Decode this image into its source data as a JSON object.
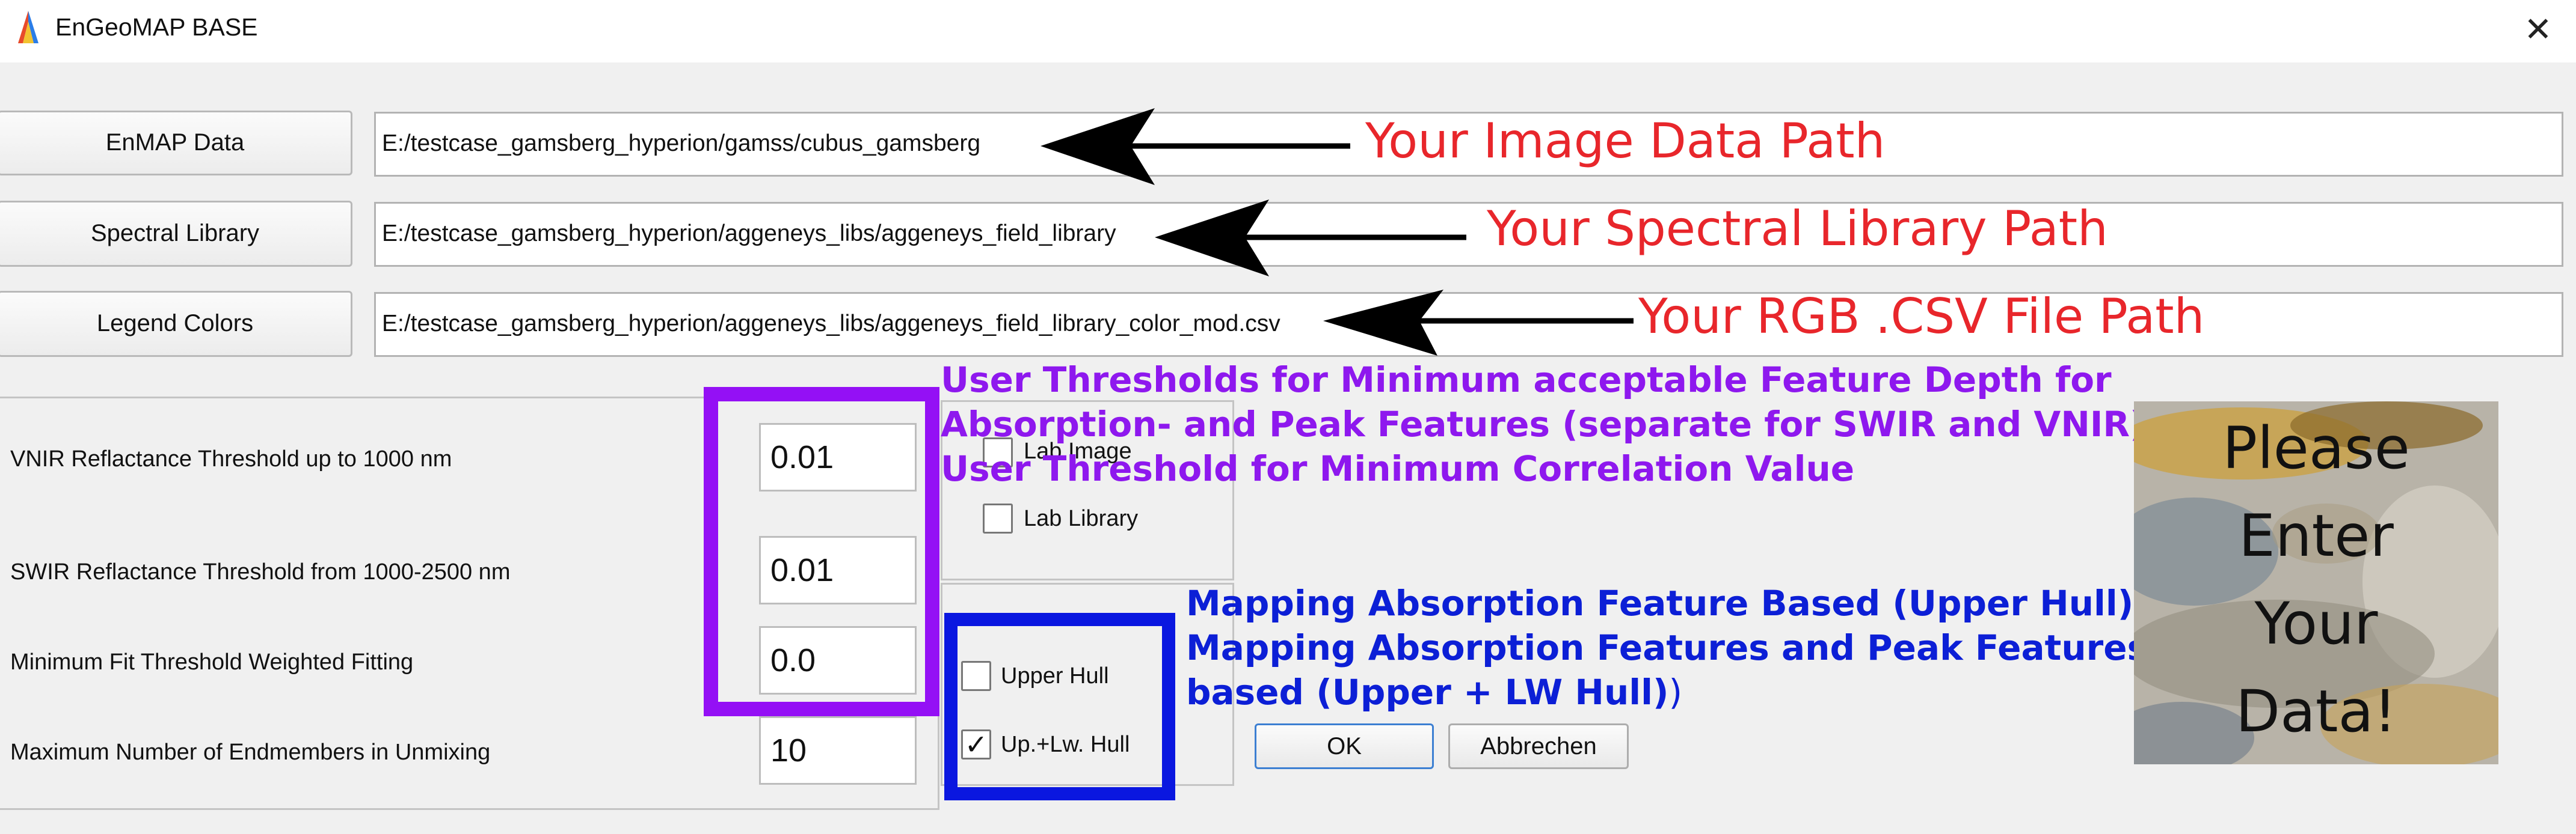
{
  "window": {
    "title": "EnGeoMAP BASE",
    "close_glyph": "✕",
    "app_icon": "rainbow-logo-icon"
  },
  "inputs": {
    "enmap": {
      "button_label": "EnMAP Data",
      "path": "E:/testcase_gamsberg_hyperion/gamss/cubus_gamsberg"
    },
    "spectral_library": {
      "button_label": "Spectral Library",
      "path": "E:/testcase_gamsberg_hyperion/aggeneys_libs/aggeneys_field_library"
    },
    "legend_colors": {
      "button_label": "Legend Colors",
      "path": "E:/testcase_gamsberg_hyperion/aggeneys_libs/aggeneys_field_library_color_mod.csv"
    }
  },
  "thresholds": {
    "vnir": {
      "label": "VNIR Reflactance Threshold up to 1000 nm",
      "value": "0.01"
    },
    "swir": {
      "label": "SWIR Reflactance Threshold from 1000-2500 nm",
      "value": "0.01"
    },
    "min_fit": {
      "label": "Minimum Fit Threshold Weighted Fitting",
      "value": "0.0"
    },
    "max_endmembers": {
      "label": "Maximum Number of Endmembers in Unmixing",
      "value": "10"
    }
  },
  "library_options": {
    "lab_image": {
      "label": "Lab Image",
      "checked": false
    },
    "lab_library": {
      "label": "Lab Library",
      "checked": false
    }
  },
  "hull_options": {
    "upper_hull": {
      "label": "Upper Hull",
      "checked": false
    },
    "up_lw_hull": {
      "label": "Up.+Lw. Hull",
      "checked": true
    },
    "check_glyph": "✓"
  },
  "dialog_buttons": {
    "ok": "OK",
    "cancel": "Abbrechen"
  },
  "annotations": {
    "image_path": "Your Image Data Path",
    "spectral_path": "Your Spectral Library Path",
    "rgb_path": "Your RGB .CSV File Path",
    "thresholds_line1": "User Thresholds for Minimum acceptable Feature Depth for",
    "thresholds_line2": "Absorption- and Peak Features (separate for SWIR and VNIR)",
    "thresholds_line3": "User Threshold for Minimum Correlation Value",
    "hull_line1": "Mapping Absorption Feature Based (Upper Hull)",
    "hull_line2": "Mapping Absorption Features and Peak Features",
    "hull_line3": "based (Upper + LW Hull)",
    "hull_line3_paren": ")"
  },
  "image_message": {
    "line1": "Please",
    "line2": "Enter",
    "line3": "Your",
    "line4": "Data!"
  },
  "colors": {
    "annotation_red": "#e8262b",
    "annotation_purple": "#8e18ee",
    "annotation_blue": "#0c1fd6",
    "highlight_purple": "#9410f5",
    "highlight_blue": "#0a17e0"
  }
}
